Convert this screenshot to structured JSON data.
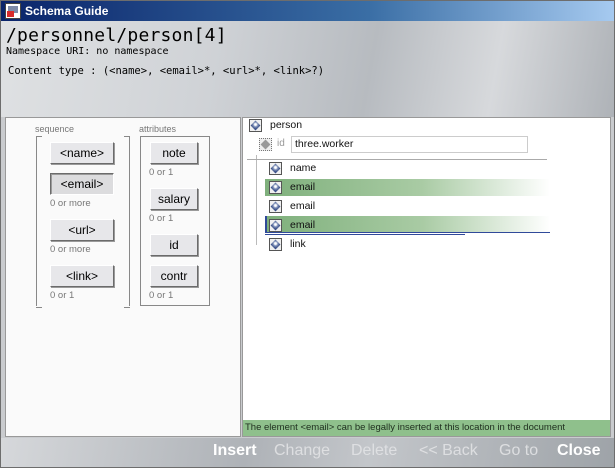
{
  "window": {
    "title": "Schema Guide"
  },
  "header": {
    "path": "/personnel/person[4]",
    "namespace": "Namespace URI: no namespace",
    "content_type": "Content type : (<name>, <email>*, <url>*, <link>?)"
  },
  "sequence": {
    "label": "sequence",
    "items": [
      {
        "label": "<name>",
        "occurrence": "",
        "pressed": false
      },
      {
        "label": "<email>",
        "occurrence": "0 or more",
        "pressed": true
      },
      {
        "label": "<url>",
        "occurrence": "0 or more",
        "pressed": false
      },
      {
        "label": "<link>",
        "occurrence": "0 or 1",
        "pressed": false
      }
    ]
  },
  "attributes": {
    "label": "attributes",
    "items": [
      {
        "label": "note",
        "occurrence": "0 or 1"
      },
      {
        "label": "salary",
        "occurrence": "0 or 1"
      },
      {
        "label": "id",
        "occurrence": ""
      },
      {
        "label": "contr",
        "occurrence": "0 or 1"
      }
    ]
  },
  "tree": {
    "root": "person",
    "attribute": {
      "name": "id",
      "value": "three.worker"
    },
    "children": [
      "name",
      "email",
      "email",
      "email",
      "link"
    ]
  },
  "status": "The element <email> can be legally inserted at this location in the document",
  "footer": {
    "insert": "Insert",
    "change": "Change",
    "delete": "Delete",
    "back": "<< Back",
    "goto": "Go to",
    "close": "Close"
  },
  "colors": {
    "title_bar": "#0a246a",
    "highlight": "#8fc08c",
    "selection_border": "#304a9a"
  }
}
